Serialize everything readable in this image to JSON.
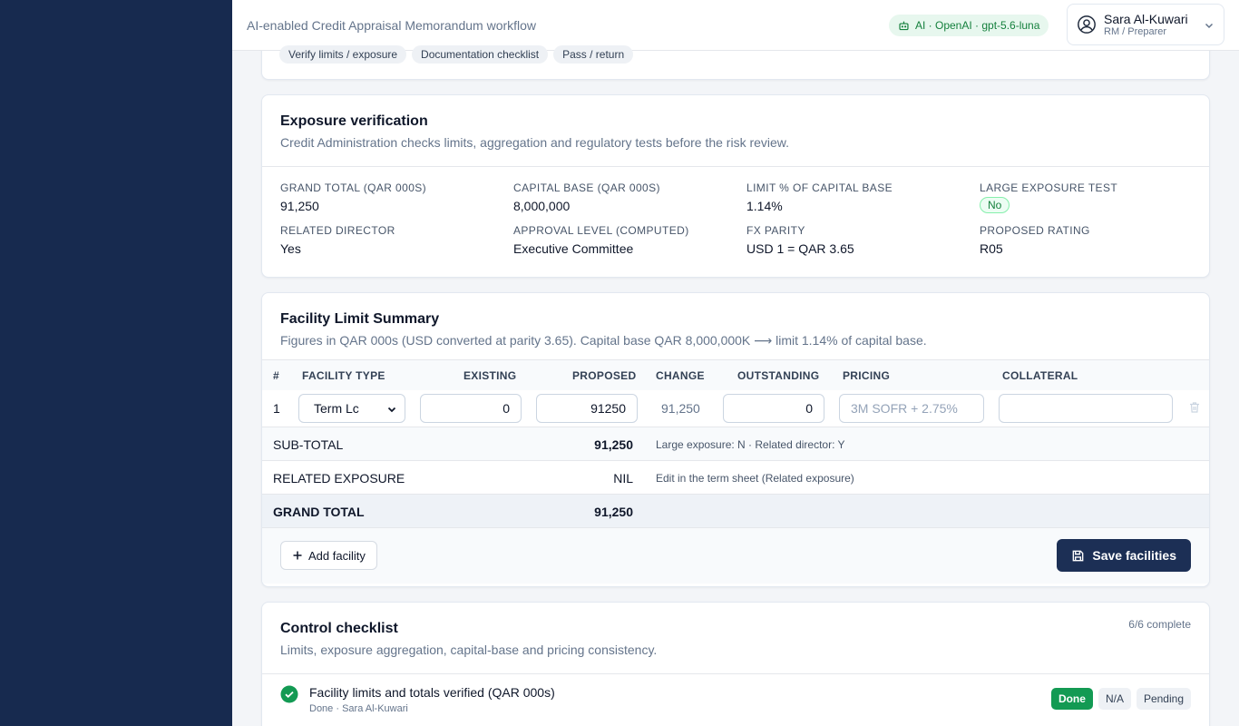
{
  "header": {
    "subtitle": "AI-enabled Credit Appraisal Memorandum workflow",
    "ai_pill": "AI · OpenAI · gpt-5.6-luna",
    "user_name": "Sara Al-Kuwari",
    "user_role": "RM / Preparer"
  },
  "chips": [
    "Verify limits / exposure",
    "Documentation checklist",
    "Pass / return"
  ],
  "exposure": {
    "title": "Exposure verification",
    "description": "Credit Administration checks limits, aggregation and regulatory tests before the risk review.",
    "fields": [
      {
        "label": "Grand total (QAR 000s)",
        "value": "91,250"
      },
      {
        "label": "Capital base (QAR 000s)",
        "value": "8,000,000"
      },
      {
        "label": "Limit % of capital base",
        "value": "1.14%"
      },
      {
        "label": "Large exposure test",
        "value": "No"
      },
      {
        "label": "Related director",
        "value": "Yes"
      },
      {
        "label": "Approval level (computed)",
        "value": "Executive Committee"
      },
      {
        "label": "FX parity",
        "value": "USD 1 = QAR 3.65"
      },
      {
        "label": "Proposed rating",
        "value": "R05"
      }
    ]
  },
  "facility": {
    "title": "Facility Limit Summary",
    "description": "Figures in QAR 000s (USD converted at parity 3.65). Capital base QAR 8,000,000K ⟶ limit 1.14% of capital base.",
    "columns": [
      "#",
      "Facility type",
      "Existing",
      "Proposed",
      "Change",
      "Outstanding",
      "Pricing",
      "Collateral"
    ],
    "rows": [
      {
        "num": "1",
        "type": "Term Lc",
        "existing": "0",
        "proposed": "91250",
        "change": "91,250",
        "outstanding": "0",
        "pricing_placeholder": "3M SOFR + 2.75%",
        "collateral": ""
      }
    ],
    "subtotal": {
      "label": "SUB-TOTAL",
      "value": "91,250",
      "note": "Large exposure: N · Related director: Y"
    },
    "related": {
      "label": "RELATED EXPOSURE",
      "value": "NIL",
      "note": "Edit in the term sheet (Related exposure)"
    },
    "grand": {
      "label": "GRAND TOTAL",
      "value": "91,250"
    },
    "add_label": "Add facility",
    "save_label": "Save facilities"
  },
  "checklist": {
    "title": "Control checklist",
    "description": "Limits, exposure aggregation, capital-base and pricing consistency.",
    "count": "6/6 complete",
    "items": [
      {
        "title": "Facility limits and totals verified (QAR 000s)",
        "sub": "Done · Sara Al-Kuwari",
        "options": [
          "Done",
          "N/A",
          "Pending"
        ],
        "selected": "Done"
      }
    ]
  },
  "colors": {
    "sidebar": "#172a4f",
    "primary_button": "#1c2f55",
    "success": "#139a53",
    "ai_pill_text": "#15803d"
  }
}
